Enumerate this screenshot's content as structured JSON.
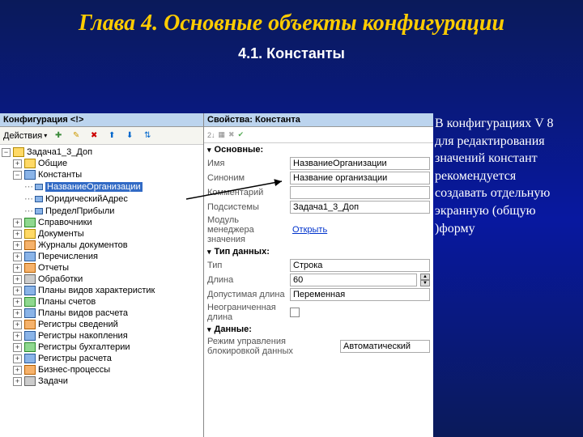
{
  "slide": {
    "title": "Глава 4. Основные объекты конфигурации",
    "subtitle": "4.1. Константы",
    "body": "В конфигурациях V 8 для редактирования значений констант рекомендуется создавать отдельную экранную (общую )форму"
  },
  "config_panel": {
    "title": "Конфигурация <!>",
    "actions_label": "Действия",
    "tree": {
      "root": "Задача1_3_Доп",
      "groups": [
        {
          "label": "Общие",
          "icon": "folder"
        },
        {
          "label": "Константы",
          "icon": "blue",
          "expanded": true,
          "children": [
            {
              "label": "НазваниеОрганизации",
              "selected": true
            },
            {
              "label": "ЮридическийАдрес"
            },
            {
              "label": "ПределПрибыли"
            }
          ]
        },
        {
          "label": "Справочники",
          "icon": "green"
        },
        {
          "label": "Документы",
          "icon": "folder"
        },
        {
          "label": "Журналы документов",
          "icon": "orange"
        },
        {
          "label": "Перечисления",
          "icon": "blue"
        },
        {
          "label": "Отчеты",
          "icon": "orange"
        },
        {
          "label": "Обработки",
          "icon": "gray"
        },
        {
          "label": "Планы видов характеристик",
          "icon": "blue"
        },
        {
          "label": "Планы счетов",
          "icon": "green"
        },
        {
          "label": "Планы видов расчета",
          "icon": "blue"
        },
        {
          "label": "Регистры сведений",
          "icon": "orange"
        },
        {
          "label": "Регистры накопления",
          "icon": "blue"
        },
        {
          "label": "Регистры бухгалтерии",
          "icon": "green"
        },
        {
          "label": "Регистры расчета",
          "icon": "blue"
        },
        {
          "label": "Бизнес-процессы",
          "icon": "orange"
        },
        {
          "label": "Задачи",
          "icon": "gray"
        }
      ]
    }
  },
  "props_panel": {
    "title": "Свойства: Константа",
    "sections": {
      "main": {
        "header": "Основные:",
        "rows": [
          {
            "label": "Имя",
            "value": "НазваниеОрганизации"
          },
          {
            "label": "Синоним",
            "value": "Название организации"
          },
          {
            "label": "Комментарий",
            "value": ""
          },
          {
            "label": "Подсистемы",
            "value": "Задача1_3_Доп"
          },
          {
            "label": "Модуль менеджера значения",
            "link": "Открыть"
          }
        ]
      },
      "type": {
        "header": "Тип данных:",
        "rows": [
          {
            "label": "Тип",
            "value": "Строка"
          },
          {
            "label": "Длина",
            "value": "60",
            "numeric": true
          },
          {
            "label": "Допустимая длина",
            "value": "Переменная"
          },
          {
            "label": "Неограниченная длина",
            "checkbox": true
          }
        ]
      },
      "data": {
        "header": "Данные:",
        "rows": [
          {
            "label": "Режим управления блокировкой данных",
            "value": "Автоматический"
          }
        ]
      }
    }
  }
}
